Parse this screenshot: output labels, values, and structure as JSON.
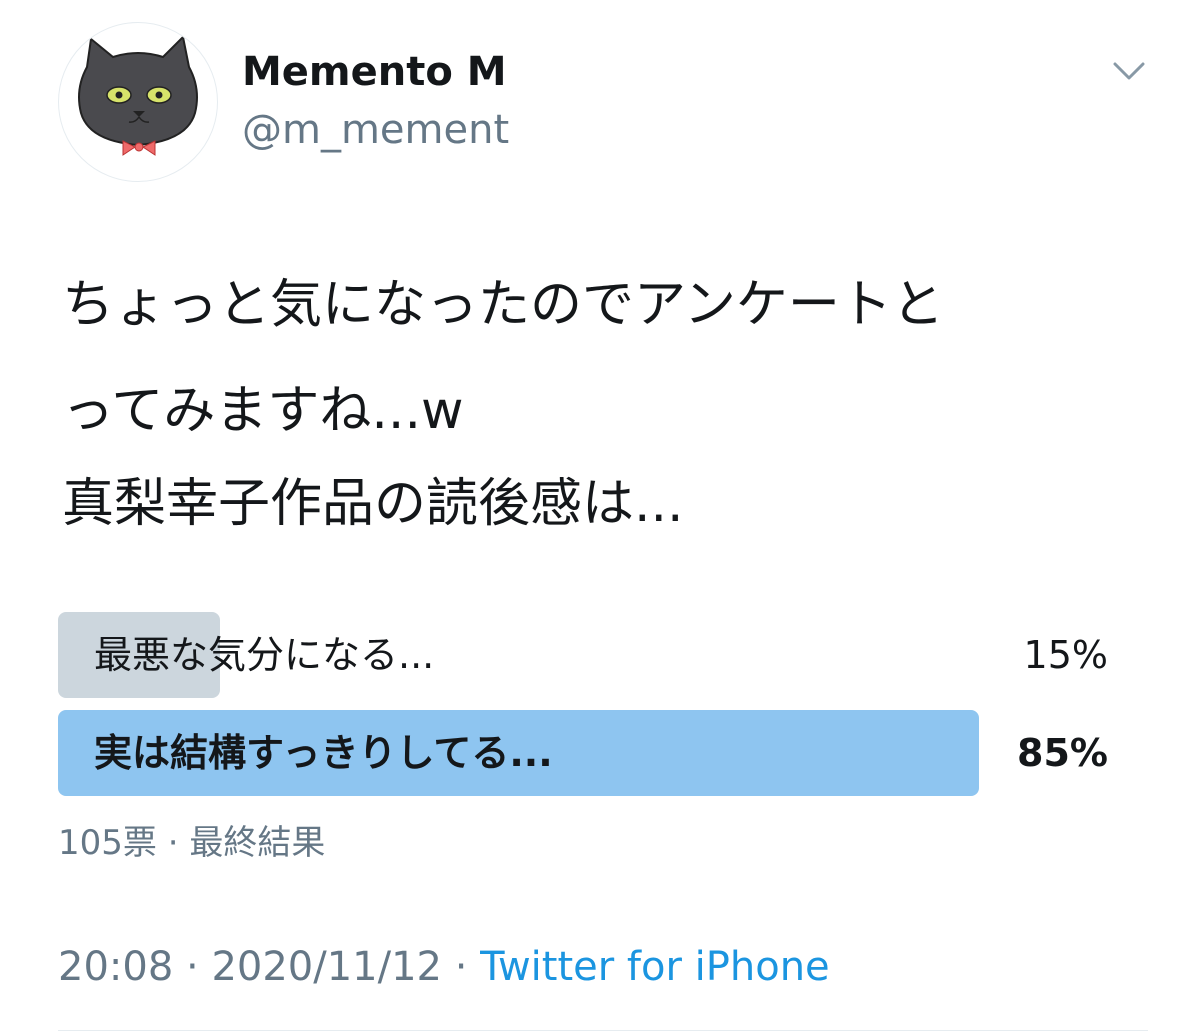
{
  "user": {
    "display_name": "Memento M",
    "handle": "@m_mement",
    "avatar_icon": "cat-icon"
  },
  "tweet": {
    "text_line1": "ちょっと気になったのでアンケートと",
    "text_line2": "ってみますね...w",
    "text_line3": "真梨幸子作品の読後感は..."
  },
  "poll": {
    "options": [
      {
        "label": "最悪な気分になる...",
        "percent_text": "15%",
        "percent": 15,
        "winner": false
      },
      {
        "label": "実は結構すっきりしてる...",
        "percent_text": "85%",
        "percent": 85,
        "winner": true
      }
    ],
    "votes": "105票",
    "separator": "·",
    "status": "最終結果"
  },
  "meta": {
    "time": "20:08",
    "date": "2020/11/12",
    "separator": "·",
    "source": "Twitter for iPhone"
  },
  "colors": {
    "loser_bar": "#ccd6dd",
    "winner_bar": "#8ec5f0",
    "link": "#1b95e0",
    "secondary_text": "#657786"
  }
}
